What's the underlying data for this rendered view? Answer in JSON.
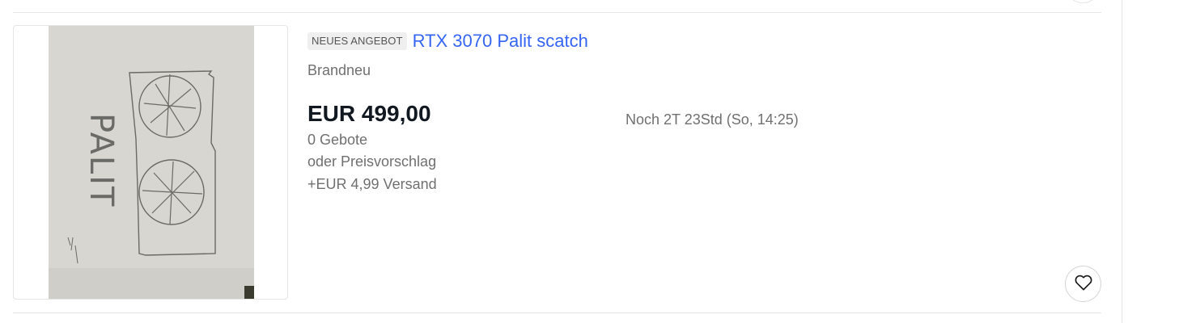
{
  "listing": {
    "badge": "NEUES ANGEBOT",
    "title": "RTX 3070 Palit scatch",
    "condition": "Brandneu",
    "price": "EUR 499,00",
    "bids": "0 Gebote",
    "best_offer": "oder Preisvorschlag",
    "shipping": "+EUR 4,99 Versand",
    "time_left": "Noch 2T 23Std (So, 14:25)",
    "image": {
      "handwritten_text": "PALIT"
    }
  },
  "colors": {
    "link": "#3665f3",
    "price": "#111820",
    "muted": "#707070",
    "badge_bg": "#efefef",
    "divider": "#e5e5e5"
  },
  "icons": {
    "watch": "heart-icon"
  }
}
